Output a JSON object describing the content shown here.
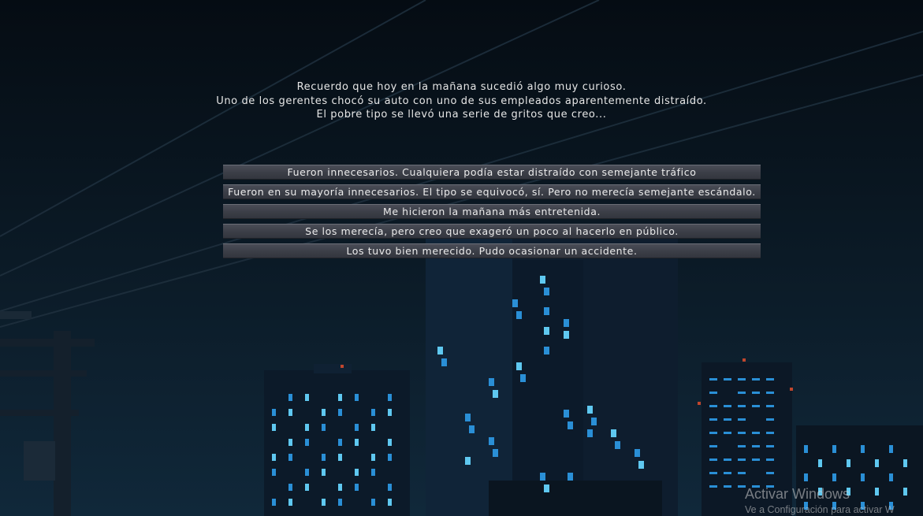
{
  "dialogue": {
    "lines": [
      "Recuerdo que hoy en la mañana sucedió algo muy curioso.",
      "Uno de los gerentes chocó su auto con uno de sus empleados aparentemente distraído.",
      "El pobre tipo se llevó una serie de gritos que creo..."
    ]
  },
  "choices": [
    "Fueron innecesarios. Cualquiera podía estar distraído con semejante tráfico",
    "Fueron en su mayoría innecesarios. El tipo se equivocó, sí. Pero no merecía semejante escándalo.",
    "Me hicieron la mañana más entretenida.",
    "Se los merecía, pero creo que exageró un poco al hacerlo en público.",
    "Los tuvo bien merecido. Pudo ocasionar un accidente."
  ],
  "watermark": {
    "title": "Activar Windows",
    "subtitle": "Ve a Configuración para activar W"
  },
  "colors": {
    "sky": "#0a1823",
    "window_glow": "#2a8fd6",
    "window_glow_bright": "#5fc8f0",
    "building": "#0d1c2c",
    "choice_bg": "#3d4049",
    "text": "#e6e6e6"
  }
}
